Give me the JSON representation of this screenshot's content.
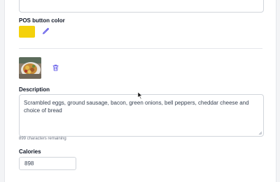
{
  "pos_color": {
    "label": "POS button color",
    "swatch_color": "#f4d10b",
    "picker_icon": "eyedropper-icon"
  },
  "image": {
    "thumbnail": "breakfast-scramble-photo",
    "delete_icon": "trash-icon"
  },
  "description": {
    "label": "Description",
    "value": "Scrambled eggs, ground sausage, bacon, green onions, bell peppers, cheddar cheese and choice of bread",
    "helper": "899 characters remaining"
  },
  "calories": {
    "label": "Calories",
    "value": "898"
  },
  "colors": {
    "accent": "#4f46e5"
  }
}
